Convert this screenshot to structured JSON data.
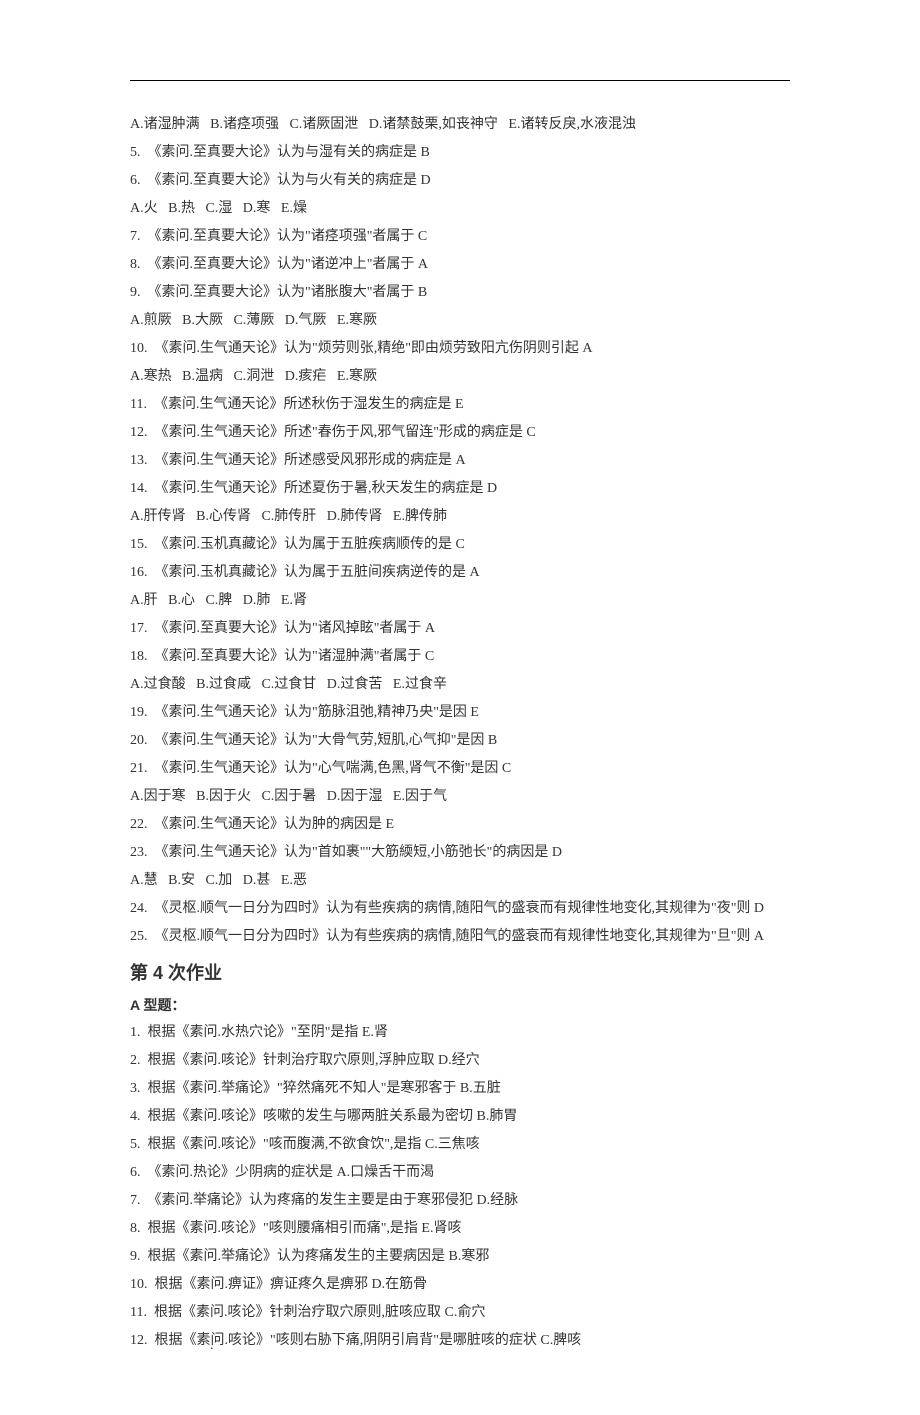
{
  "lines": [
    "A.诸湿肿满   B.诸痉项强   C.诸厥固泄   D.诸禁鼓栗,如丧神守   E.诸转反戾,水液混浊",
    "5.  《素问.至真要大论》认为与湿有关的病症是 B",
    "6.  《素问.至真要大论》认为与火有关的病症是 D",
    "A.火   B.热   C.湿   D.寒   E.燥",
    "7.  《素问.至真要大论》认为\"诸痉项强\"者属于 C",
    "8.  《素问.至真要大论》认为\"诸逆冲上\"者属于 A",
    "9.  《素问.至真要大论》认为\"诸胀腹大\"者属于 B",
    "A.煎厥   B.大厥   C.薄厥   D.气厥   E.寒厥",
    "10.  《素问.生气通天论》认为\"烦劳则张,精绝\"即由烦劳致阳亢伤阴则引起 A",
    "A.寒热   B.温病   C.洞泄   D.痎疟   E.寒厥",
    "11.  《素问.生气通天论》所述秋伤于湿发生的病症是 E",
    "12.  《素问.生气通天论》所述\"春伤于风,邪气留连\"形成的病症是 C",
    "13.  《素问.生气通天论》所述感受风邪形成的病症是 A",
    "14.  《素问.生气通天论》所述夏伤于暑,秋天发生的病症是 D",
    "A.肝传肾   B.心传肾   C.肺传肝   D.肺传肾   E.脾传肺",
    "15.  《素问.玉机真藏论》认为属于五脏疾病顺传的是 C",
    "16.  《素问.玉机真藏论》认为属于五脏间疾病逆传的是 A",
    "A.肝   B.心   C.脾   D.肺   E.肾",
    "17.  《素问.至真要大论》认为\"诸风掉眩\"者属于 A",
    "18.  《素问.至真要大论》认为\"诸湿肿满\"者属于 C",
    "A.过食酸   B.过食咸   C.过食甘   D.过食苦   E.过食辛",
    "19.  《素问.生气通天论》认为\"筋脉沮弛,精神乃央\"是因 E",
    "20.  《素问.生气通天论》认为\"大骨气劳,短肌,心气抑\"是因 B",
    "21.  《素问.生气通天论》认为\"心气喘满,色黑,肾气不衡\"是因 C",
    "A.因于寒   B.因于火   C.因于暑   D.因于湿   E.因于气",
    "22.  《素问.生气通天论》认为肿的病因是 E",
    "23.  《素问.生气通天论》认为\"首如裹\"\"大筋緛短,小筋弛长\"的病因是 D",
    "A.慧   B.安   C.加   D.甚   E.恶",
    "24.  《灵枢.顺气一日分为四时》认为有些疾病的病情,随阳气的盛衰而有规律性地变化,其规律为\"夜\"则 D",
    "25.  《灵枢.顺气一日分为四时》认为有些疾病的病情,随阳气的盛衰而有规律性地变化,其规律为\"旦\"则 A"
  ],
  "heading": "第 4 次作业",
  "subhead": "A 型题：",
  "lines2": [
    "1.  根据《素问.水热穴论》\"至阴\"是指 E.肾",
    "2.  根据《素问.咳论》针刺治疗取穴原则,浮肿应取 D.经穴",
    "3.  根据《素问.举痛论》\"猝然痛死不知人\"是寒邪客于 B.五脏",
    "4.  根据《素问.咳论》咳嗽的发生与哪两脏关系最为密切 B.肺胃",
    "5.  根据《素问.咳论》\"咳而腹满,不欲食饮\",是指 C.三焦咳",
    "6.  《素问.热论》少阴病的症状是 A.口燥舌干而渴",
    "7.  《素问.举痛论》认为疼痛的发生主要是由于寒邪侵犯 D.经脉",
    "8.  根据《素问.咳论》\"咳则腰痛相引而痛\",是指 E.肾咳",
    "9.  根据《素问.举痛论》认为疼痛发生的主要病因是 B.寒邪",
    "10.  根据《素问.痹证》痹证疼久是痹邪 D.在筋骨",
    "11.  根据《素问.咳论》针刺治疗取穴原则,脏咳应取 C.俞穴",
    "12.  根据《素问.咳论》\"咳则右胁下痛,阴阴引肩背\"是哪脏咳的症状 C.脾咳"
  ],
  "footdot": "."
}
